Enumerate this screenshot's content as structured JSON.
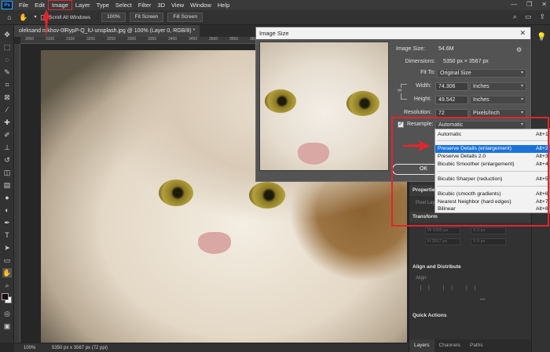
{
  "menubar": {
    "logo": "Ps",
    "items": [
      "File",
      "Edit",
      "Image",
      "Layer",
      "Type",
      "Select",
      "Filter",
      "3D",
      "View",
      "Window",
      "Help"
    ],
    "controls": [
      "—",
      "❐",
      "✕"
    ]
  },
  "options_bar": {
    "scroll_all_windows": "Scroll All Windows",
    "zoom_value": "100%",
    "fit_screen": "Fit Screen",
    "fill_screen": "Fill Screen"
  },
  "document": {
    "tab_title": "oleksand   rokhov-0lRypP-Q_lU-unsplash.jpg @ 100% (Layer 0, RGB/8) *",
    "ruler_ticks": [
      "3050",
      "3100",
      "3150",
      "3200",
      "3250",
      "3300",
      "3350",
      "3400",
      "3450",
      "3500",
      "3550",
      "3600",
      "3650",
      "3700",
      "3750",
      "3800",
      "3850",
      "3900",
      "3950"
    ]
  },
  "status_bar": {
    "zoom": "100%",
    "dimensions": "5350 px x 3567 px (72 ppi)"
  },
  "dialog": {
    "title": "Image Size",
    "close": "✕",
    "image_size_label": "Image Size:",
    "image_size_value": "54.6M",
    "dimensions_label": "Dimensions:",
    "dimensions_value": "5350 px  ×  3567 px",
    "fit_to_label": "Fit To:",
    "fit_to_value": "Original Size",
    "width_label": "Width:",
    "width_value": "74.306",
    "width_unit": "Inches",
    "height_label": "Height:",
    "height_value": "49.542",
    "height_unit": "Inches",
    "resolution_label": "Resolution:",
    "resolution_value": "72",
    "resolution_unit": "Pixels/Inch",
    "resample_label": "Resample:",
    "resample_value": "Automatic",
    "ok_label": "OK"
  },
  "resample_menu": {
    "items": [
      {
        "label": "Automatic",
        "shortcut": "Alt+1",
        "selected": false
      },
      {
        "label": "Preserve Details (enlargement)",
        "shortcut": "Alt+2",
        "selected": true
      },
      {
        "label": "Preserve Details 2.0",
        "shortcut": "Alt+3",
        "selected": false
      },
      {
        "label": "Bicubic Smoother (enlargement)",
        "shortcut": "Alt+4",
        "selected": false
      },
      {
        "label": "Bicubic Sharper (reduction)",
        "shortcut": "Alt+5",
        "selected": false
      },
      {
        "label": "Bicubic (smooth gradients)",
        "shortcut": "Alt+6",
        "selected": false
      },
      {
        "label": "Nearest Neighbor (hard edges)",
        "shortcut": "Alt+7",
        "selected": false
      },
      {
        "label": "Bilinear",
        "shortcut": "Alt+8",
        "selected": false
      }
    ]
  },
  "panels": {
    "properties": "Properties",
    "pixel_layer": "Pixel Layer",
    "transform": "Transform",
    "transform_w": "W  5350 px",
    "transform_x": "X  0 px",
    "transform_h": "H  3567 px",
    "transform_y": "Y  0 px",
    "align": "Align and Distribute",
    "align_sub": "Align:",
    "quick_actions": "Quick Actions",
    "tabs": [
      "Layers",
      "Channels",
      "Paths"
    ]
  },
  "colors": {
    "accent": "#e0262d",
    "selection": "#1a73d9"
  }
}
